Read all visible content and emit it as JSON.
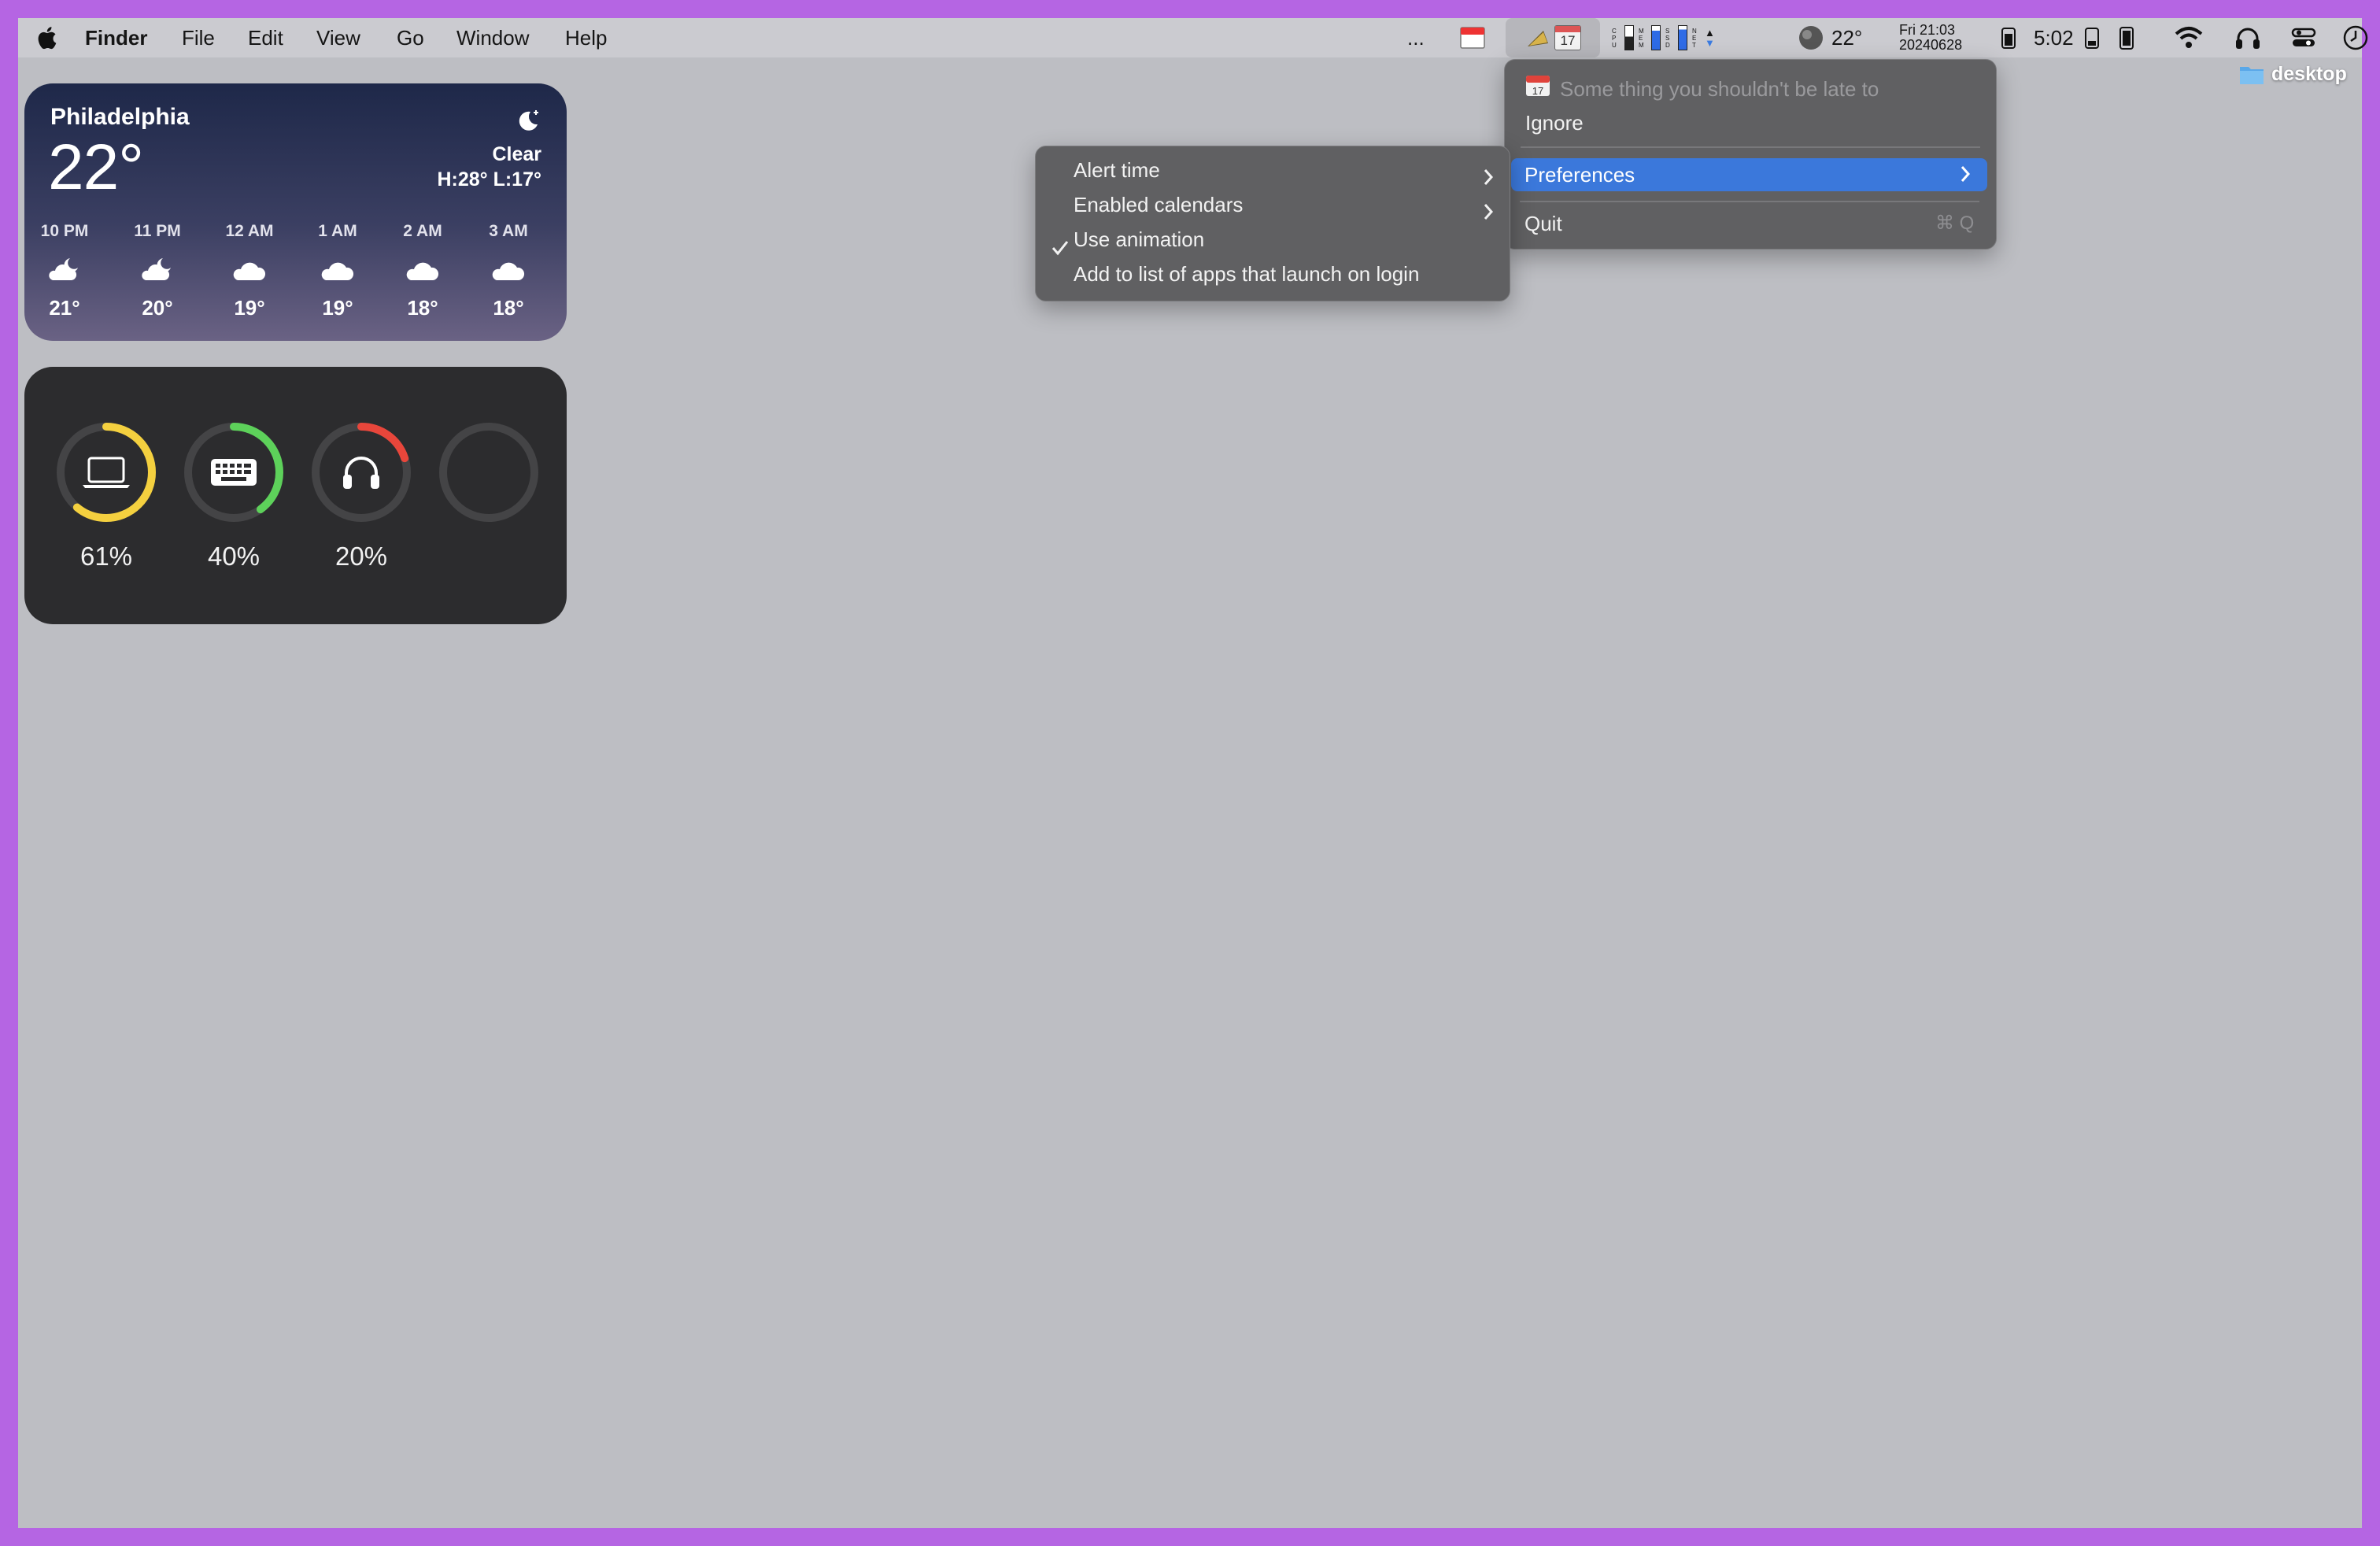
{
  "menubar": {
    "app_name": "Finder",
    "menus": [
      "File",
      "Edit",
      "View",
      "Go",
      "Window",
      "Help"
    ],
    "overflow": "...",
    "cal_day": "17",
    "stats_labels": [
      "CPU",
      "MEM",
      "SSD",
      "NET"
    ],
    "weather_temp": "22°",
    "datetime_line1": "Fri 21:03",
    "datetime_line2": "20240628",
    "clock": "5:02",
    "icons": [
      "apple-icon",
      "calendar-icon",
      "bell-icon",
      "stats-icon",
      "weather-icon",
      "battery-icon",
      "wifi-icon",
      "headphones-icon",
      "control-center-icon",
      "clock-icon"
    ]
  },
  "desktop": {
    "folder_label": "desktop"
  },
  "weather_widget": {
    "city": "Philadelphia",
    "temp": "22°",
    "condition": "Clear",
    "high_low": "H:28° L:17°",
    "hours": [
      {
        "time": "10 PM",
        "icon": "partly-cloudy-night-icon",
        "temp": "21°"
      },
      {
        "time": "11 PM",
        "icon": "partly-cloudy-night-icon",
        "temp": "20°"
      },
      {
        "time": "12 AM",
        "icon": "cloud-icon",
        "temp": "19°"
      },
      {
        "time": "1 AM",
        "icon": "cloud-icon",
        "temp": "19°"
      },
      {
        "time": "2 AM",
        "icon": "cloud-icon",
        "temp": "18°"
      },
      {
        "time": "3 AM",
        "icon": "cloud-icon",
        "temp": "18°"
      }
    ]
  },
  "battery_widget": {
    "devices": [
      {
        "name": "laptop",
        "icon": "laptop-icon",
        "level": 0.61,
        "label": "61%",
        "color": "#f4d03f"
      },
      {
        "name": "keyboard",
        "icon": "keyboard-icon",
        "level": 0.4,
        "label": "40%",
        "color": "#5dd15a"
      },
      {
        "name": "headphones",
        "icon": "headphones-icon",
        "level": 0.2,
        "label": "20%",
        "color": "#e8463b"
      },
      {
        "name": "empty",
        "icon": "",
        "level": 0,
        "label": "",
        "color": "#444446"
      }
    ]
  },
  "event_menu": {
    "event_title": "Some thing you shouldn't be late to",
    "ignore": "Ignore",
    "preferences": "Preferences",
    "quit": "Quit",
    "quit_shortcut": "⌘ Q"
  },
  "preferences_submenu": {
    "items": [
      {
        "label": "Alert time",
        "has_submenu": true,
        "checked": false
      },
      {
        "label": "Enabled calendars",
        "has_submenu": true,
        "checked": false
      },
      {
        "label": "Use animation",
        "has_submenu": false,
        "checked": true
      },
      {
        "label": "Add to list of apps that launch on login",
        "has_submenu": false,
        "checked": false
      }
    ]
  },
  "colors": {
    "highlight": "#3b78db",
    "border": "#b565e3",
    "desktop": "#bdbec3"
  }
}
